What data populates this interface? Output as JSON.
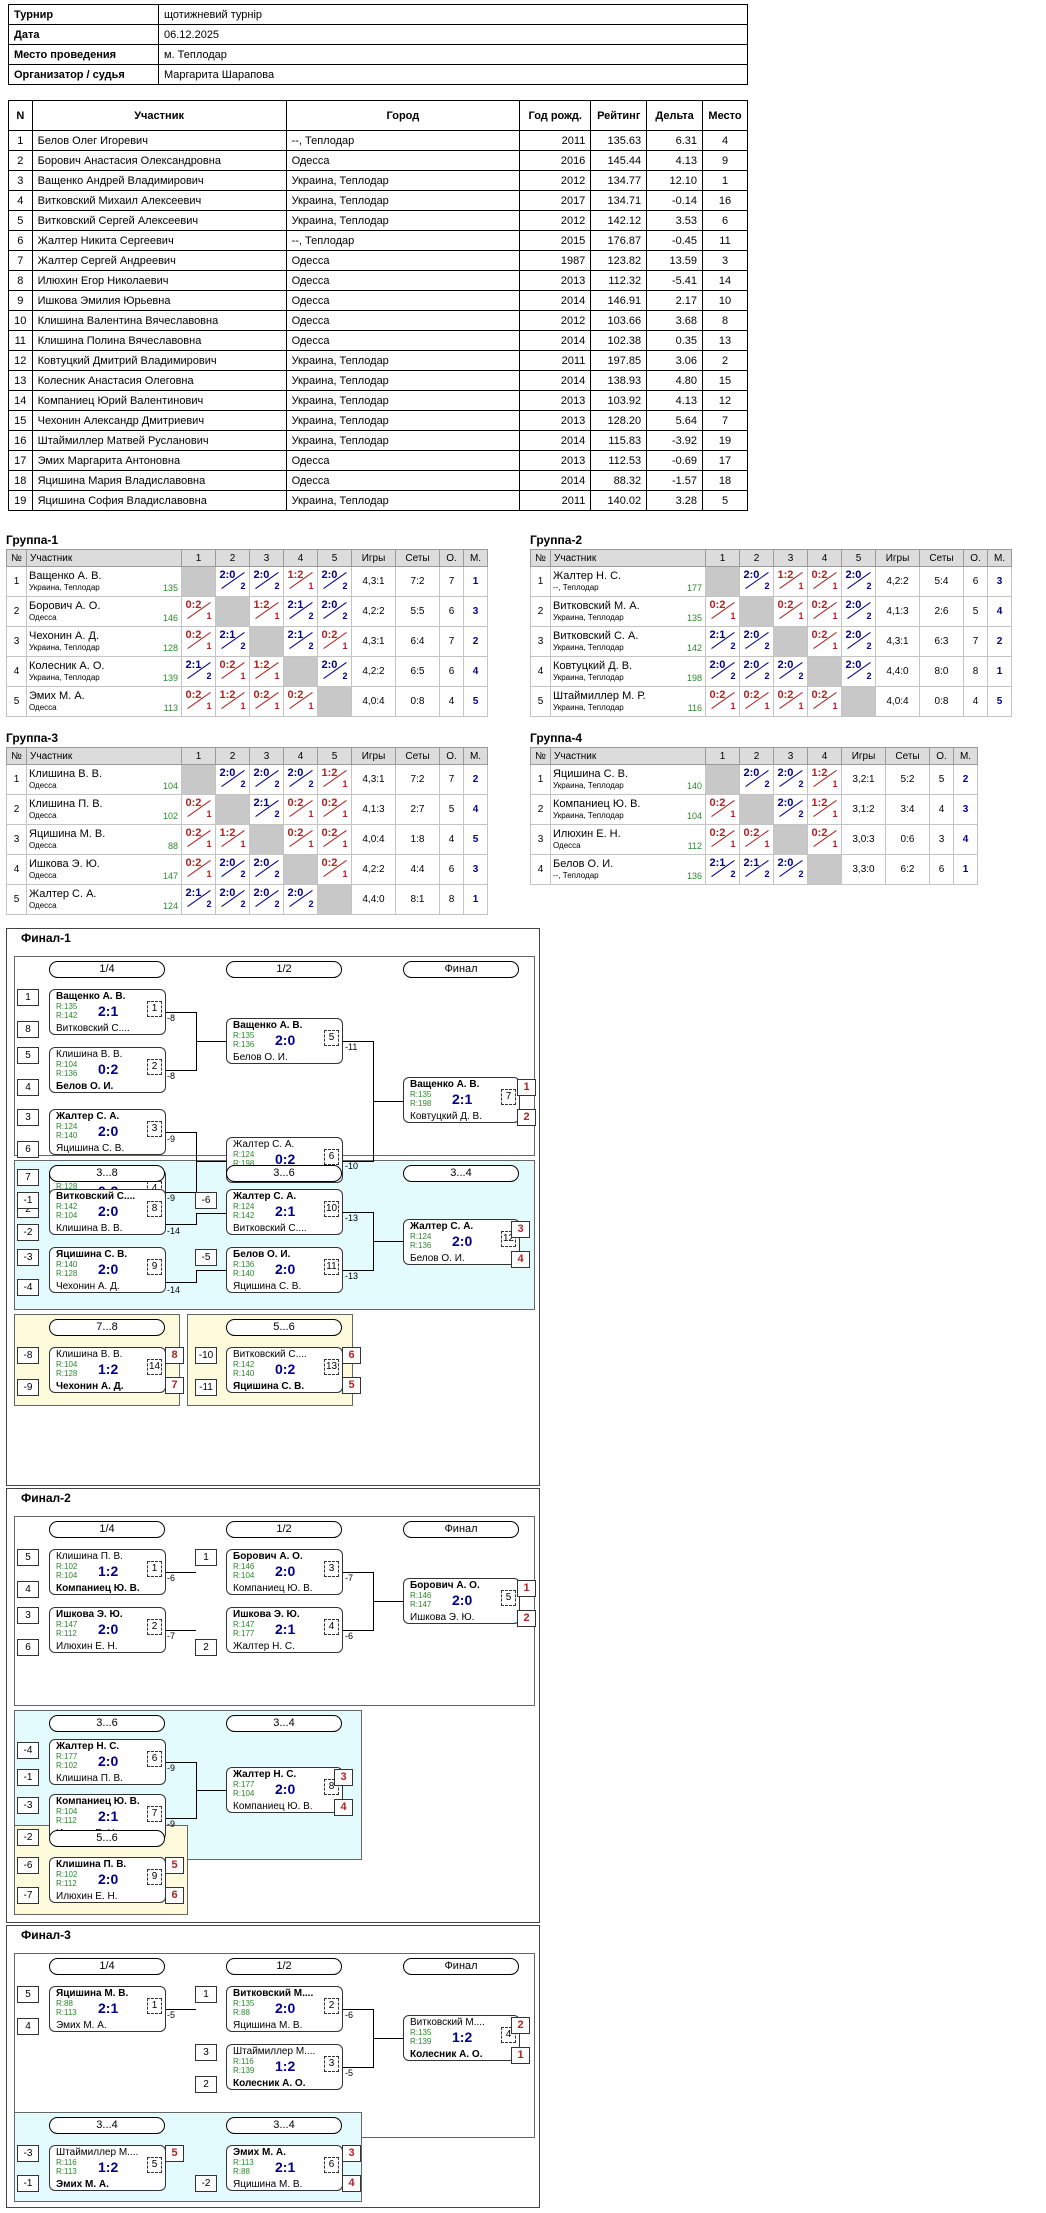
{
  "info": [
    {
      "key": "Турнир",
      "value": "щотижневий турнір"
    },
    {
      "key": "Дата",
      "value": "06.12.2025"
    },
    {
      "key": "Место проведения",
      "value": "м. Теплодар"
    },
    {
      "key": "Организатор / судья",
      "value": "Маргарита Шарапова"
    }
  ],
  "parts_headers": [
    "N",
    "Участник",
    "Город",
    "Год рожд.",
    "Рейтинг",
    "Дельта",
    "Место"
  ],
  "participants": [
    [
      "1",
      "Белов Олег Игоревич",
      "--, Теплодар",
      "2011",
      "135.63",
      "6.31",
      "4"
    ],
    [
      "2",
      "Борович Анастасия Олександровна",
      "Одесса",
      "2016",
      "145.44",
      "4.13",
      "9"
    ],
    [
      "3",
      "Ващенко Андрей Владимирович",
      "Украина, Теплодар",
      "2012",
      "134.77",
      "12.10",
      "1"
    ],
    [
      "4",
      "Витковский Михаил Алексеевич",
      "Украина, Теплодар",
      "2017",
      "134.71",
      "-0.14",
      "16"
    ],
    [
      "5",
      "Витковский Сергей Алексеевич",
      "Украина, Теплодар",
      "2012",
      "142.12",
      "3.53",
      "6"
    ],
    [
      "6",
      "Жалтер Никита Сергеевич",
      "--, Теплодар",
      "2015",
      "176.87",
      "-0.45",
      "11"
    ],
    [
      "7",
      "Жалтер Сергей Андреевич",
      "Одесса",
      "1987",
      "123.82",
      "13.59",
      "3"
    ],
    [
      "8",
      "Илюхин Егор Николаевич",
      "Одесса",
      "2013",
      "112.32",
      "-5.41",
      "14"
    ],
    [
      "9",
      "Ишкова Эмилия Юрьевна",
      "Одесса",
      "2014",
      "146.91",
      "2.17",
      "10"
    ],
    [
      "10",
      "Клишина Валентина Вячеславовна",
      "Одесса",
      "2012",
      "103.66",
      "3.68",
      "8"
    ],
    [
      "11",
      "Клишина Полина Вячеславовна",
      "Одесса",
      "2014",
      "102.38",
      "0.35",
      "13"
    ],
    [
      "12",
      "Ковтуцкий Дмитрий Владимирович",
      "Украина, Теплодар",
      "2011",
      "197.85",
      "3.06",
      "2"
    ],
    [
      "13",
      "Колесник Анастасия Олеговна",
      "Украина, Теплодар",
      "2014",
      "138.93",
      "4.80",
      "15"
    ],
    [
      "14",
      "Компаниец Юрий Валентинович",
      "Украина, Теплодар",
      "2013",
      "103.92",
      "4.13",
      "12"
    ],
    [
      "15",
      "Чехонин Александр Дмитриевич",
      "Украина, Теплодар",
      "2013",
      "128.20",
      "5.64",
      "7"
    ],
    [
      "16",
      "Штаймиллер Матвей Русланович",
      "Украина, Теплодар",
      "2014",
      "115.83",
      "-3.92",
      "19"
    ],
    [
      "17",
      "Эмих Маргарита Антоновна",
      "Одесса",
      "2013",
      "112.53",
      "-0.69",
      "17"
    ],
    [
      "18",
      "Яцишина Мария Владиславовна",
      "Одесса",
      "2014",
      "88.32",
      "-1.57",
      "18"
    ],
    [
      "19",
      "Яцишина София Владиславовна",
      "Украина, Теплодар",
      "2011",
      "140.02",
      "3.28",
      "5"
    ]
  ],
  "group_headers": {
    "num": "№",
    "name": "Участник",
    "games": "Игры",
    "sets": "Сеты",
    "pts": "О.",
    "place": "М."
  },
  "groups": [
    {
      "title": "Группа-1",
      "rows": [
        {
          "n": "1",
          "name": "Ващенко А. В.",
          "city": "Украина, Теплодар",
          "rating": "135",
          "res": [
            "x",
            "2:0|2",
            "2:0|2",
            "1:2|1",
            "2:0|2"
          ],
          "games": "4,3:1",
          "sets": "7:2",
          "pts": "7",
          "place": "1"
        },
        {
          "n": "2",
          "name": "Борович А. О.",
          "city": "Одесса",
          "rating": "146",
          "res": [
            "0:2|1",
            "x",
            "1:2|1",
            "2:1|2",
            "2:0|2"
          ],
          "games": "4,2:2",
          "sets": "5:5",
          "pts": "6",
          "place": "3"
        },
        {
          "n": "3",
          "name": "Чехонин А. Д.",
          "city": "Украина, Теплодар",
          "rating": "128",
          "res": [
            "0:2|1",
            "2:1|2",
            "x",
            "2:1|2",
            "0:2|1"
          ],
          "games": "4,3:1",
          "sets": "6:4",
          "pts": "7",
          "place": "2"
        },
        {
          "n": "4",
          "name": "Колесник А. О.",
          "city": "Украина, Теплодар",
          "rating": "139",
          "res": [
            "2:1|2",
            "0:2|1",
            "1:2|1",
            "x",
            "2:0|2"
          ],
          "games": "4,2:2",
          "sets": "6:5",
          "pts": "6",
          "place": "4"
        },
        {
          "n": "5",
          "name": "Эмих М. А.",
          "city": "Одесса",
          "rating": "113",
          "res": [
            "0:2|1",
            "1:2|1",
            "0:2|1",
            "0:2|1",
            "x"
          ],
          "games": "4,0:4",
          "sets": "0:8",
          "pts": "4",
          "place": "5"
        }
      ]
    },
    {
      "title": "Группа-2",
      "rows": [
        {
          "n": "1",
          "name": "Жалтер Н. С.",
          "city": "--, Теплодар",
          "rating": "177",
          "res": [
            "x",
            "2:0|2",
            "1:2|1",
            "0:2|1",
            "2:0|2"
          ],
          "games": "4,2:2",
          "sets": "5:4",
          "pts": "6",
          "place": "3"
        },
        {
          "n": "2",
          "name": "Витковский М. А.",
          "city": "Украина, Теплодар",
          "rating": "135",
          "res": [
            "0:2|1",
            "x",
            "0:2|1",
            "0:2|1",
            "2:0|2"
          ],
          "games": "4,1:3",
          "sets": "2:6",
          "pts": "5",
          "place": "4"
        },
        {
          "n": "3",
          "name": "Витковский С. А.",
          "city": "Украина, Теплодар",
          "rating": "142",
          "res": [
            "2:1|2",
            "2:0|2",
            "x",
            "0:2|1",
            "2:0|2"
          ],
          "games": "4,3:1",
          "sets": "6:3",
          "pts": "7",
          "place": "2"
        },
        {
          "n": "4",
          "name": "Ковтуцкий Д. В.",
          "city": "Украина, Теплодар",
          "rating": "198",
          "res": [
            "2:0|2",
            "2:0|2",
            "2:0|2",
            "x",
            "2:0|2"
          ],
          "games": "4,4:0",
          "sets": "8:0",
          "pts": "8",
          "place": "1"
        },
        {
          "n": "5",
          "name": "Штаймиллер М. Р.",
          "city": "Украина, Теплодар",
          "rating": "116",
          "res": [
            "0:2|1",
            "0:2|1",
            "0:2|1",
            "0:2|1",
            "x"
          ],
          "games": "4,0:4",
          "sets": "0:8",
          "pts": "4",
          "place": "5"
        }
      ]
    },
    {
      "title": "Группа-3",
      "rows": [
        {
          "n": "1",
          "name": "Клишина В. В.",
          "city": "Одесса",
          "rating": "104",
          "res": [
            "x",
            "2:0|2",
            "2:0|2",
            "2:0|2",
            "1:2|1"
          ],
          "games": "4,3:1",
          "sets": "7:2",
          "pts": "7",
          "place": "2"
        },
        {
          "n": "2",
          "name": "Клишина П. В.",
          "city": "Одесса",
          "rating": "102",
          "res": [
            "0:2|1",
            "x",
            "2:1|2",
            "0:2|1",
            "0:2|1"
          ],
          "games": "4,1:3",
          "sets": "2:7",
          "pts": "5",
          "place": "4"
        },
        {
          "n": "3",
          "name": "Яцишина М. В.",
          "city": "Одесса",
          "rating": "88",
          "res": [
            "0:2|1",
            "1:2|1",
            "x",
            "0:2|1",
            "0:2|1"
          ],
          "games": "4,0:4",
          "sets": "1:8",
          "pts": "4",
          "place": "5"
        },
        {
          "n": "4",
          "name": "Ишкова Э. Ю.",
          "city": "Одесса",
          "rating": "147",
          "res": [
            "0:2|1",
            "2:0|2",
            "2:0|2",
            "x",
            "0:2|1"
          ],
          "games": "4,2:2",
          "sets": "4:4",
          "pts": "6",
          "place": "3"
        },
        {
          "n": "5",
          "name": "Жалтер С. А.",
          "city": "Одесса",
          "rating": "124",
          "res": [
            "2:1|2",
            "2:0|2",
            "2:0|2",
            "2:0|2",
            "x"
          ],
          "games": "4,4:0",
          "sets": "8:1",
          "pts": "8",
          "place": "1"
        }
      ]
    },
    {
      "title": "Группа-4",
      "rows": [
        {
          "n": "1",
          "name": "Яцишина С. В.",
          "city": "Украина, Теплодар",
          "rating": "140",
          "res": [
            "x",
            "2:0|2",
            "2:0|2",
            "1:2|1"
          ],
          "games": "3,2:1",
          "sets": "5:2",
          "pts": "5",
          "place": "2"
        },
        {
          "n": "2",
          "name": "Компаниец Ю. В.",
          "city": "Украина, Теплодар",
          "rating": "104",
          "res": [
            "0:2|1",
            "x",
            "2:0|2",
            "1:2|1"
          ],
          "games": "3,1:2",
          "sets": "3:4",
          "pts": "4",
          "place": "3"
        },
        {
          "n": "3",
          "name": "Илюхин Е. Н.",
          "city": "Одесса",
          "rating": "112",
          "res": [
            "0:2|1",
            "0:2|1",
            "x",
            "0:2|1"
          ],
          "games": "3,0:3",
          "sets": "0:6",
          "pts": "3",
          "place": "4"
        },
        {
          "n": "4",
          "name": "Белов О. И.",
          "city": "--, Теплодар",
          "rating": "136",
          "res": [
            "2:1|2",
            "2:1|2",
            "2:0|2",
            "x"
          ],
          "games": "3,3:0",
          "sets": "6:2",
          "pts": "6",
          "place": "1"
        }
      ]
    }
  ],
  "finals": [
    {
      "title": "Финал-1",
      "pills": [
        "1/4",
        "1/2",
        "Финал",
        "3...8",
        "3...6",
        "3...4",
        "7...8",
        "5...6"
      ],
      "matches": [
        {
          "p1": "Ващенко А. В.",
          "r1": "R:135",
          "r2": "R:142",
          "p2": "Витковский С....",
          "score": "2:1",
          "m": "1",
          "w": 1
        },
        {
          "p1": "Клишина В. В.",
          "r1": "R:104",
          "r2": "R:136",
          "p2": "Белов О. И.",
          "score": "0:2",
          "m": "2",
          "w": 2
        },
        {
          "p1": "Жалтер С. А.",
          "r1": "R:124",
          "r2": "R:140",
          "p2": "Яцишина С. В.",
          "score": "2:0",
          "m": "3",
          "w": 1
        },
        {
          "p1": "Чехонин А. Д.",
          "r1": "R:128",
          "r2": "R:198",
          "p2": "Ковтуцкий Д. В.",
          "score": "0:2",
          "m": "4",
          "w": 2
        },
        {
          "p1": "Ващенко А. В.",
          "r1": "R:135",
          "r2": "R:136",
          "p2": "Белов О. И.",
          "score": "2:0",
          "m": "5",
          "w": 1
        },
        {
          "p1": "Жалтер С. А.",
          "r1": "R:124",
          "r2": "R:198",
          "p2": "Ковтуцкий Д. В.",
          "score": "0:2",
          "m": "6",
          "w": 2
        },
        {
          "p1": "Ващенко А. В.",
          "r1": "R:135",
          "r2": "R:198",
          "p2": "Ковтуцкий Д. В.",
          "score": "2:1",
          "m": "7",
          "w": 1
        },
        {
          "p1": "Витковский С....",
          "r1": "R:142",
          "r2": "R:104",
          "p2": "Клишина В. В.",
          "score": "2:0",
          "m": "8",
          "w": 1
        },
        {
          "p1": "Яцишина С. В.",
          "r1": "R:140",
          "r2": "R:128",
          "p2": "Чехонин А. Д.",
          "score": "2:0",
          "m": "9",
          "w": 1
        },
        {
          "p1": "Жалтер С. А.",
          "r1": "R:124",
          "r2": "R:142",
          "p2": "Витковский С....",
          "score": "2:1",
          "m": "10",
          "w": 1
        },
        {
          "p1": "Белов О. И.",
          "r1": "R:136",
          "r2": "R:140",
          "p2": "Яцишина С. В.",
          "score": "2:0",
          "m": "11",
          "w": 1
        },
        {
          "p1": "Жалтер С. А.",
          "r1": "R:124",
          "r2": "R:136",
          "p2": "Белов О. И.",
          "score": "2:0",
          "m": "12",
          "w": 1
        },
        {
          "p1": "Клишина В. В.",
          "r1": "R:104",
          "r2": "R:128",
          "p2": "Чехонин А. Д.",
          "score": "1:2",
          "m": "14",
          "w": 2
        },
        {
          "p1": "Витковский С....",
          "r1": "R:142",
          "r2": "R:140",
          "p2": "Яцишина С. В.",
          "score": "0:2",
          "m": "13",
          "w": 2
        }
      ],
      "seeds": [
        "1",
        "8",
        "5",
        "4",
        "3",
        "6",
        "7",
        "2",
        "-1",
        "-2",
        "-3",
        "-4",
        "-6",
        "-5",
        "-8",
        "-9",
        "-10",
        "-11"
      ],
      "loser_labels": [
        "-8",
        "-8",
        "-9",
        "-9",
        "-11",
        "-10",
        "-14",
        "-14",
        "-13",
        "-13"
      ],
      "final_places": [
        "1",
        "2",
        "3",
        "4",
        "8",
        "7",
        "6",
        "5"
      ]
    },
    {
      "title": "Финал-2",
      "pills": [
        "1/4",
        "1/2",
        "Финал",
        "3...6",
        "3...4",
        "5...6"
      ],
      "matches": [
        {
          "p1": "Клишина П. В.",
          "r1": "R:102",
          "r2": "R:104",
          "p2": "Компаниец Ю. В.",
          "score": "1:2",
          "m": "1",
          "w": 2
        },
        {
          "p1": "Ишкова Э. Ю.",
          "r1": "R:147",
          "r2": "R:112",
          "p2": "Илюхин Е. Н.",
          "score": "2:0",
          "m": "2",
          "w": 1
        },
        {
          "p1": "Борович А. О.",
          "r1": "R:146",
          "r2": "R:104",
          "p2": "Компаниец Ю. В.",
          "score": "2:0",
          "m": "3",
          "w": 1
        },
        {
          "p1": "Ишкова Э. Ю.",
          "r1": "R:147",
          "r2": "R:177",
          "p2": "Жалтер Н. С.",
          "score": "2:1",
          "m": "4",
          "w": 1
        },
        {
          "p1": "Борович А. О.",
          "r1": "R:146",
          "r2": "R:147",
          "p2": "Ишкова Э. Ю.",
          "score": "2:0",
          "m": "5",
          "w": 1
        },
        {
          "p1": "Жалтер Н. С.",
          "r1": "R:177",
          "r2": "R:102",
          "p2": "Клишина П. В.",
          "score": "2:0",
          "m": "6",
          "w": 1
        },
        {
          "p1": "Компаниец Ю. В.",
          "r1": "R:104",
          "r2": "R:112",
          "p2": "Илюхин Е. Н.",
          "score": "2:1",
          "m": "7",
          "w": 1
        },
        {
          "p1": "Жалтер Н. С.",
          "r1": "R:177",
          "r2": "R:104",
          "p2": "Компаниец Ю. В.",
          "score": "2:0",
          "m": "8",
          "w": 1
        },
        {
          "p1": "Клишина П. В.",
          "r1": "R:102",
          "r2": "R:112",
          "p2": "Илюхин Е. Н.",
          "score": "2:0",
          "m": "9",
          "w": 1
        }
      ],
      "seeds": [
        "5",
        "4",
        "3",
        "6",
        "1",
        "2",
        "-4",
        "-1",
        "-3",
        "-2",
        "-6",
        "-7"
      ],
      "loser_labels": [
        "-6",
        "-7",
        "-7",
        "-6",
        "-9",
        "-9"
      ],
      "final_places": [
        "1",
        "2",
        "3",
        "4",
        "5",
        "6"
      ]
    },
    {
      "title": "Финал-3",
      "pills": [
        "1/4",
        "1/2",
        "Финал",
        "3...4",
        "3...4"
      ],
      "matches": [
        {
          "p1": "Яцишина М. В.",
          "r1": "R:88",
          "r2": "R:113",
          "p2": "Эмих М. А.",
          "score": "2:1",
          "m": "1",
          "w": 1
        },
        {
          "p1": "Витковский М....",
          "r1": "R:135",
          "r2": "R:88",
          "p2": "Яцишина М. В.",
          "score": "2:0",
          "m": "2",
          "w": 1
        },
        {
          "p1": "Штаймиллер М....",
          "r1": "R:116",
          "r2": "R:139",
          "p2": "Колесник А. О.",
          "score": "1:2",
          "m": "3",
          "w": 2
        },
        {
          "p1": "Витковский М....",
          "r1": "R:135",
          "r2": "R:139",
          "p2": "Колесник А. О.",
          "score": "1:2",
          "m": "4",
          "w": 2
        },
        {
          "p1": "Штаймиллер М....",
          "r1": "R:116",
          "r2": "R:113",
          "p2": "Эмих М. А.",
          "score": "1:2",
          "m": "5",
          "w": 2
        },
        {
          "p1": "Эмих М. А.",
          "r1": "R:113",
          "r2": "R:88",
          "p2": "Яцишина М. В.",
          "score": "2:1",
          "m": "6",
          "w": 1
        }
      ],
      "seeds": [
        "5",
        "4",
        "1",
        "3",
        "2",
        "-3",
        "-1",
        "-2"
      ],
      "loser_labels": [
        "-5",
        "-6",
        "-5"
      ],
      "final_places": [
        "2",
        "1",
        "5",
        "3",
        "4"
      ]
    }
  ]
}
